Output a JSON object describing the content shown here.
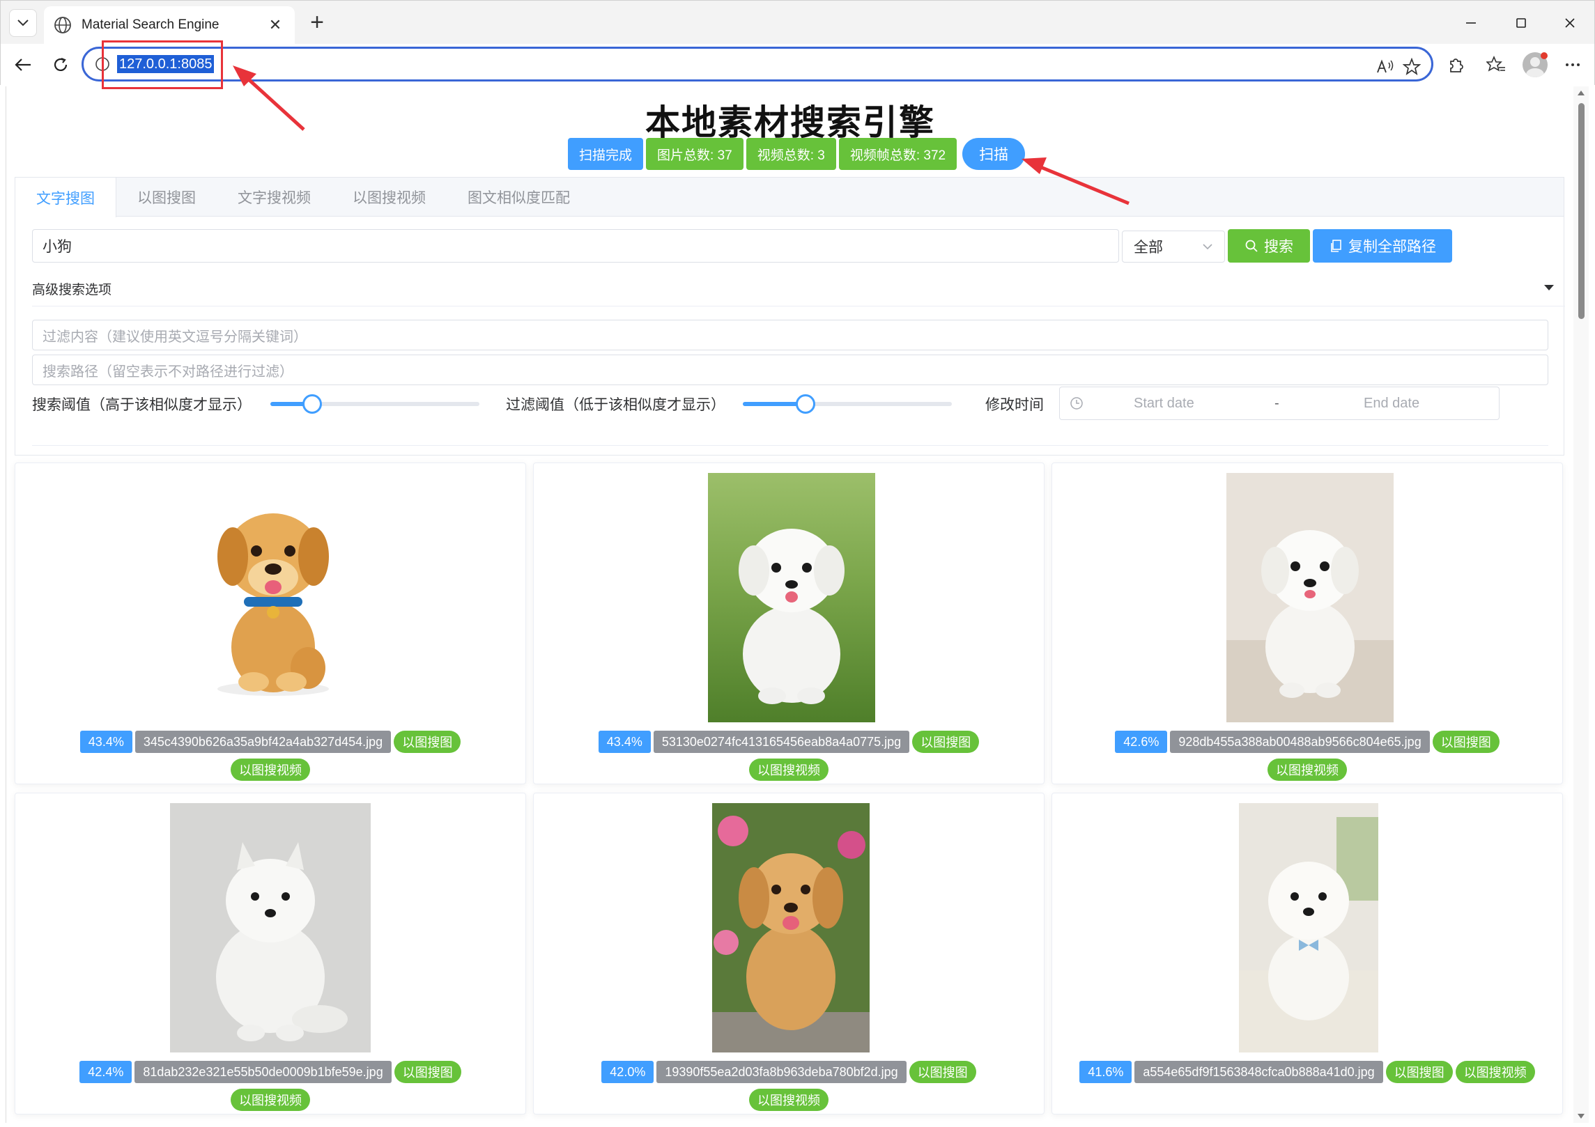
{
  "browser": {
    "tab_title": "Material Search Engine",
    "tab_close": "✕",
    "new_tab": "+",
    "url": "127.0.0.1:8085"
  },
  "page": {
    "title": "本地素材搜索引擎",
    "status": {
      "scan_state": "扫描完成",
      "image_total": "图片总数: 37",
      "video_total": "视频总数: 3",
      "frame_total": "视频帧总数: 372",
      "scan_button": "扫描"
    },
    "tabs": [
      {
        "label": "文字搜图"
      },
      {
        "label": "以图搜图"
      },
      {
        "label": "文字搜视频"
      },
      {
        "label": "以图搜视频"
      },
      {
        "label": "图文相似度匹配"
      }
    ],
    "search": {
      "query": "小狗",
      "scope": "全部",
      "search_button": "搜索",
      "copy_button": "复制全部路径"
    },
    "advanced": {
      "title": "高级搜索选项",
      "filter_placeholder": "过滤内容（建议使用英文逗号分隔关键词）",
      "path_placeholder": "搜索路径（留空表示不对路径进行过滤）",
      "search_threshold_label": "搜索阈值（高于该相似度才显示）",
      "search_threshold_value": 0.2,
      "filter_threshold_label": "过滤阈值（低于该相似度才显示）",
      "filter_threshold_value": 0.3,
      "modified_time_label": "修改时间",
      "start_placeholder": "Start date",
      "range_separator": "-",
      "end_placeholder": "End date"
    },
    "results": [
      {
        "score": "43.4%",
        "file": "345c4390b626a35a9bf42a4ab327d454.jpg",
        "action1": "以图搜图",
        "action2": "以图搜视频"
      },
      {
        "score": "43.4%",
        "file": "53130e0274fc413165456eab8a4a0775.jpg",
        "action1": "以图搜图",
        "action2": "以图搜视频"
      },
      {
        "score": "42.6%",
        "file": "928db455a388ab00488ab9566c804e65.jpg",
        "action1": "以图搜图",
        "action2": "以图搜视频"
      },
      {
        "score": "42.4%",
        "file": "81dab232e321e55b50de0009b1bfe59e.jpg",
        "action1": "以图搜图",
        "action2": "以图搜视频"
      },
      {
        "score": "42.0%",
        "file": "19390f55ea2d03fa8b963deba780bf2d.jpg",
        "action1": "以图搜图",
        "action2": "以图搜视频"
      },
      {
        "score": "41.6%",
        "file": "a554e65df9f1563848cfca0b888a41d0.jpg",
        "action1": "以图搜图",
        "action2": "以图搜视频"
      }
    ]
  },
  "colors": {
    "primary": "#409eff",
    "success": "#67c23a",
    "info": "#909399",
    "annotation": "#e8333a"
  }
}
